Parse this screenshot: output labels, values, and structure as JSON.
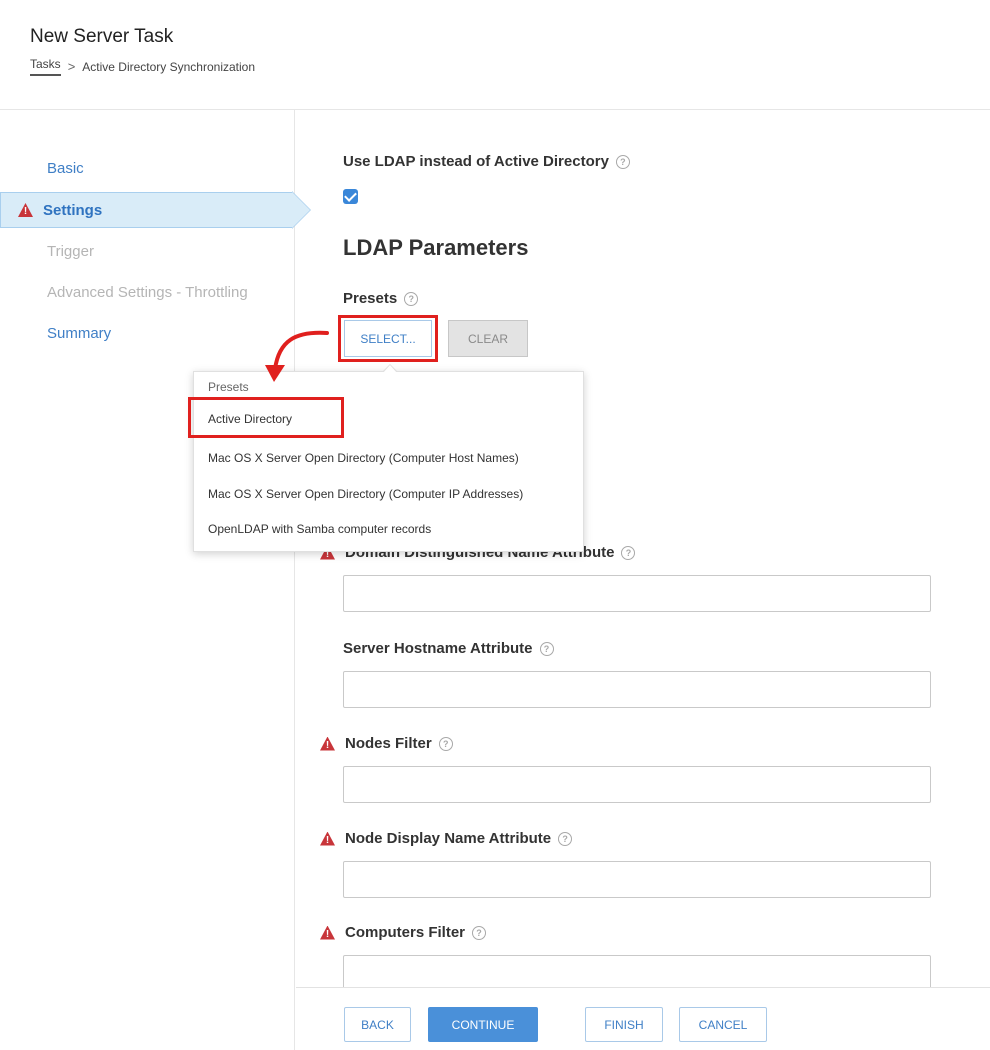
{
  "header": {
    "title": "New Server Task",
    "breadcrumb": {
      "root": "Tasks",
      "separator": ">",
      "current": "Active Directory Synchronization"
    }
  },
  "sidebar": {
    "items": [
      {
        "label": "Basic",
        "state": "link"
      },
      {
        "label": "Settings",
        "state": "active-warning"
      },
      {
        "label": "Trigger",
        "state": "disabled"
      },
      {
        "label": "Advanced Settings - Throttling",
        "state": "disabled"
      },
      {
        "label": "Summary",
        "state": "link"
      }
    ]
  },
  "settings": {
    "use_ldap": {
      "label": "Use LDAP instead of Active Directory",
      "checked": true
    },
    "section_heading": "LDAP Parameters",
    "presets": {
      "label": "Presets",
      "select_label": "SELECT...",
      "clear_label": "CLEAR",
      "dropdown": {
        "header": "Presets",
        "options": [
          "Active Directory",
          "Mac OS X Server Open Directory (Computer Host Names)",
          "Mac OS X Server Open Directory (Computer IP Addresses)",
          "OpenLDAP with Samba computer records"
        ]
      }
    },
    "fields": [
      {
        "label": "Domain Distinguished Name Attribute",
        "warning": true,
        "value": ""
      },
      {
        "label": "Server Hostname Attribute",
        "warning": false,
        "value": ""
      },
      {
        "label": "Nodes Filter",
        "warning": true,
        "value": ""
      },
      {
        "label": "Node Display Name Attribute",
        "warning": true,
        "value": ""
      },
      {
        "label": "Computers Filter",
        "warning": true,
        "value": ""
      }
    ]
  },
  "footer": {
    "back": "BACK",
    "continue": "CONTINUE",
    "finish": "FINISH",
    "cancel": "CANCEL"
  },
  "colors": {
    "link_blue": "#3f7fc6",
    "primary_button": "#4a90d9",
    "warning_red": "#c8353a",
    "annotation_red": "#e0201e",
    "active_nav_bg": "#d9ecf8"
  },
  "icons": {
    "warning": "warning-triangle-icon",
    "help": "help-circle-icon",
    "checkbox": "checkbox-checked-icon",
    "breadcrumb_separator": "chevron-right-icon"
  }
}
